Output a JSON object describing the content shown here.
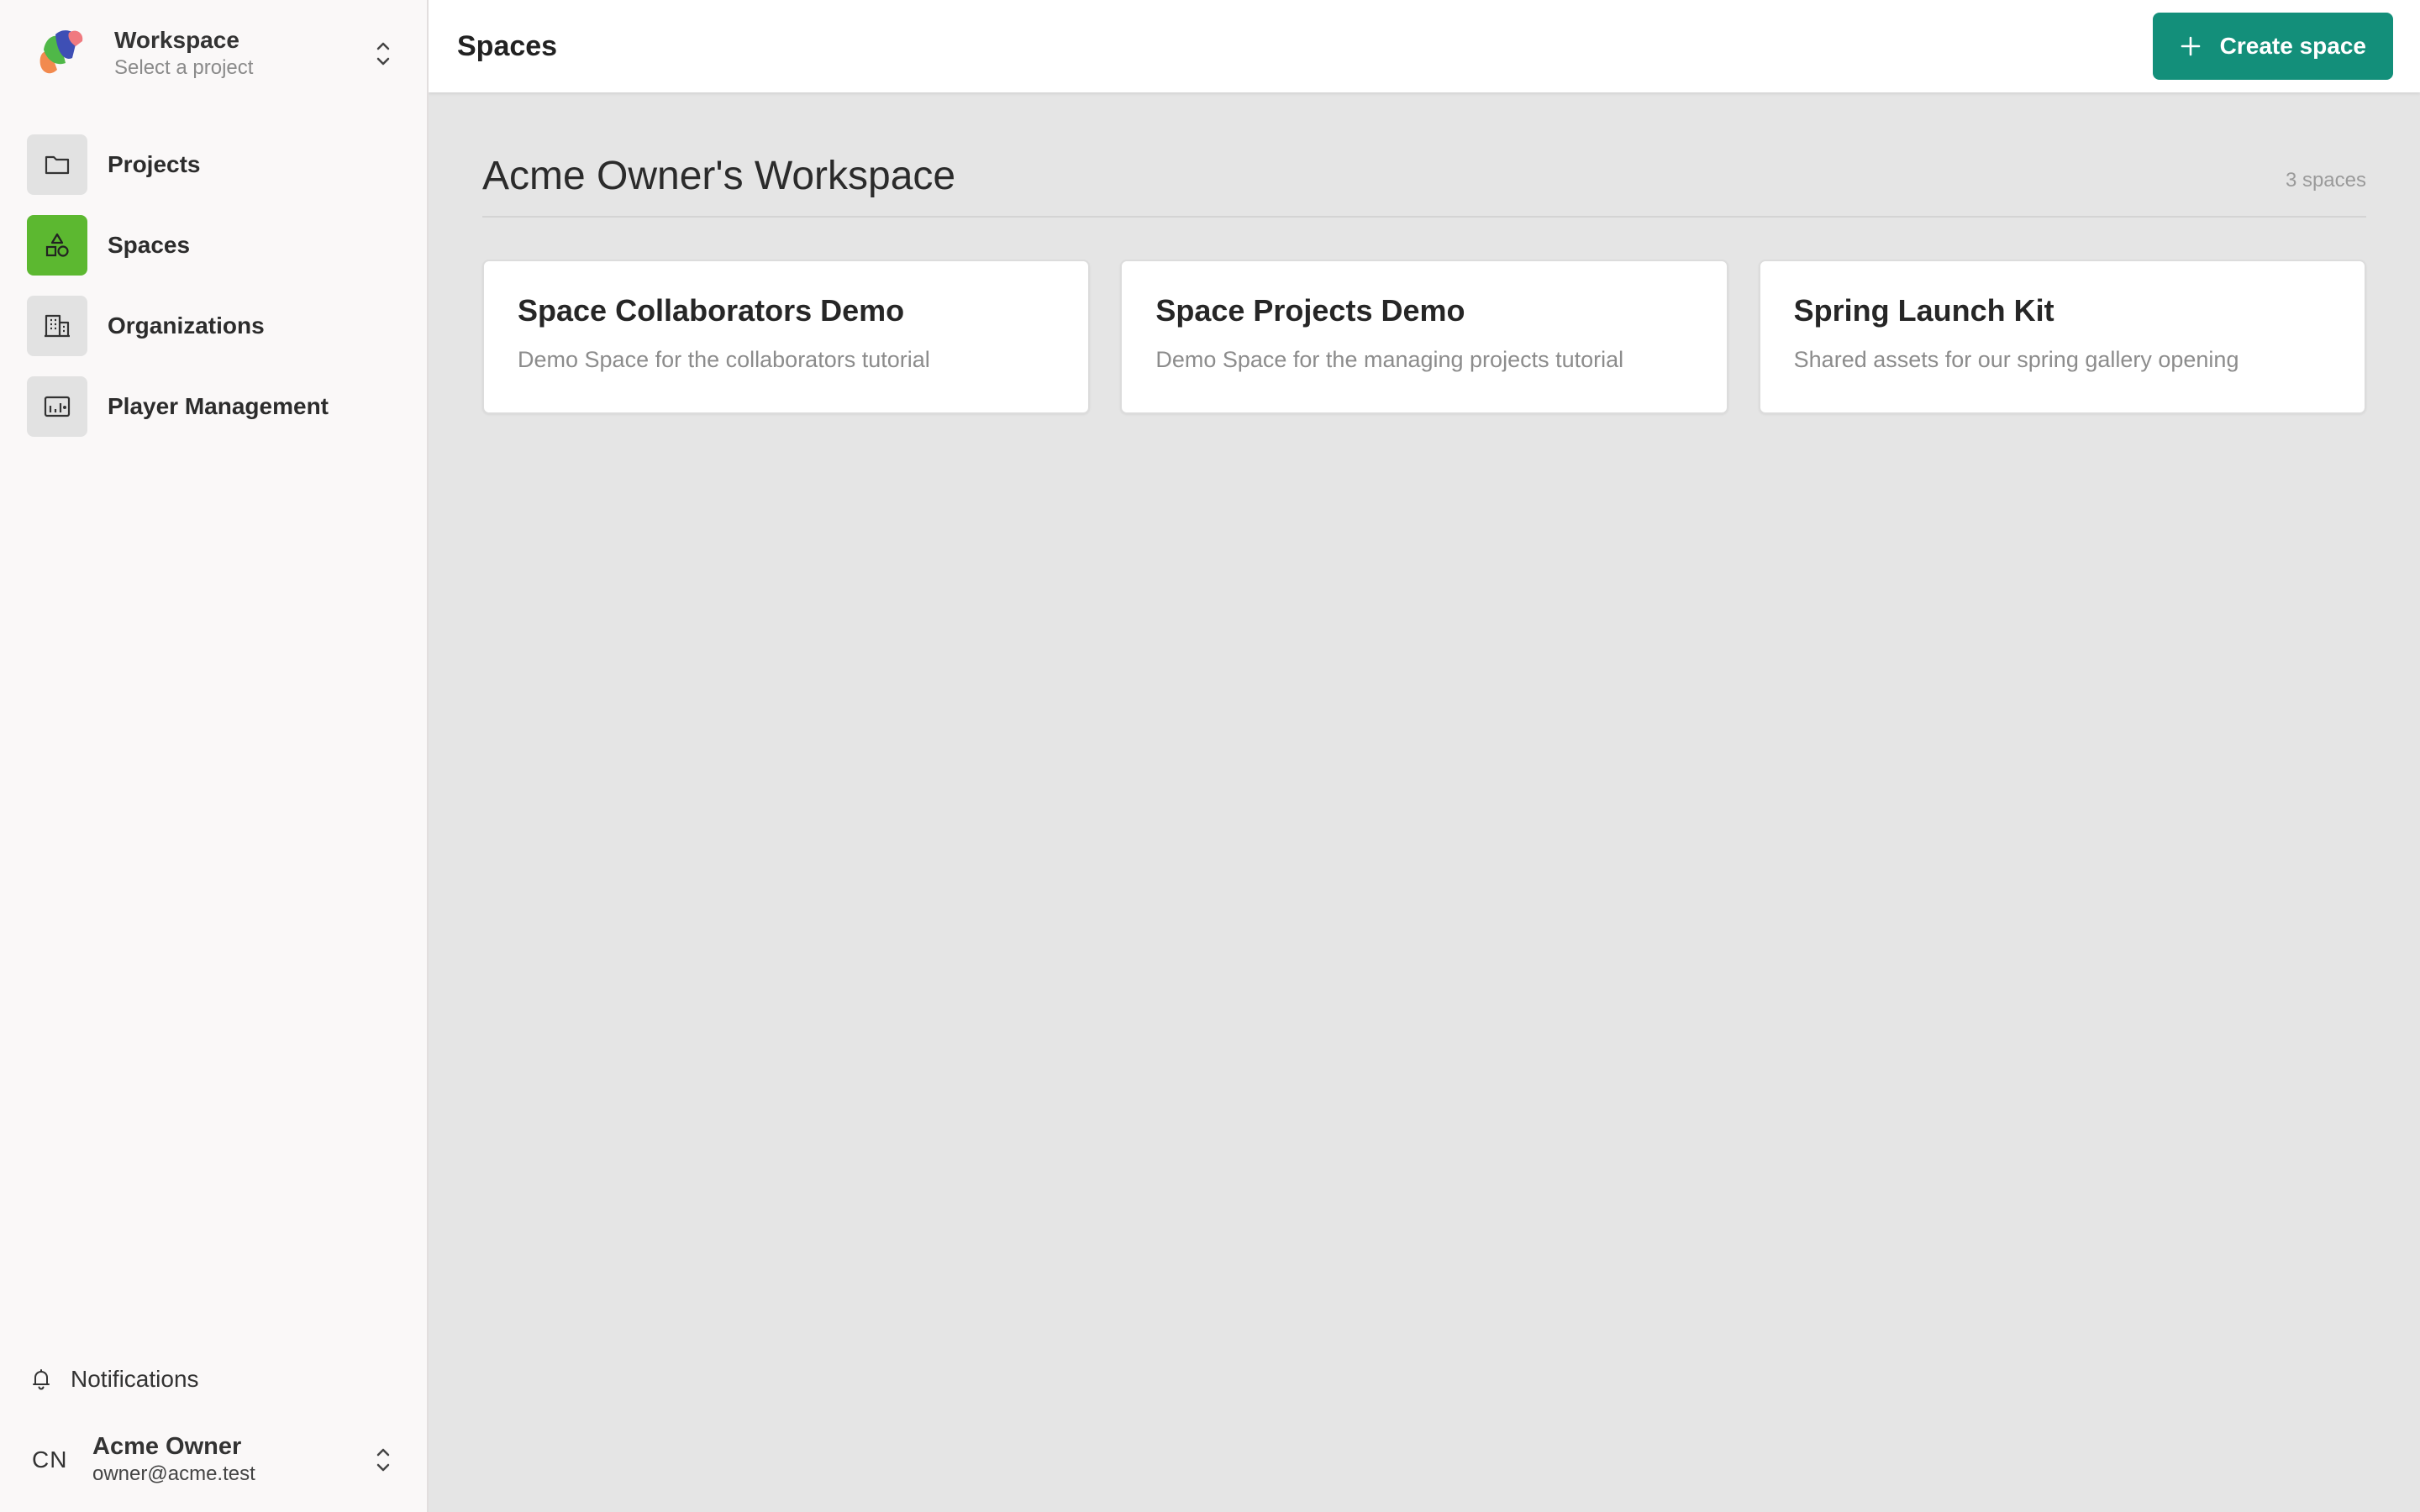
{
  "workspace_switcher": {
    "title": "Workspace",
    "subtitle": "Select a project",
    "logo_icon": "workspace-logo",
    "chevron_icon": "chevron-up-down-icon"
  },
  "sidebar": {
    "items": [
      {
        "label": "Projects",
        "icon": "folder-icon",
        "active": false
      },
      {
        "label": "Spaces",
        "icon": "shapes-icon",
        "active": true
      },
      {
        "label": "Organizations",
        "icon": "building-icon",
        "active": false
      },
      {
        "label": "Player Management",
        "icon": "player-management-icon",
        "active": false
      }
    ],
    "notifications_label": "Notifications",
    "user": {
      "initials": "CN",
      "name": "Acme Owner",
      "email": "owner@acme.test"
    }
  },
  "header": {
    "title": "Spaces",
    "create_label": "Create space"
  },
  "main": {
    "workspace_heading": "Acme Owner's Workspace",
    "spaces_count": "3 spaces",
    "cards": [
      {
        "title": "Space Collaborators Demo",
        "description": "Demo Space for the collaborators tutorial"
      },
      {
        "title": "Space Projects Demo",
        "description": "Demo Space for the managing projects tutorial"
      },
      {
        "title": "Spring Launch Kit",
        "description": "Shared assets for our spring gallery opening"
      }
    ]
  },
  "colors": {
    "accent": "#138f7a",
    "active_nav": "#5cb830",
    "background": "#e5e5e5",
    "sidebar_bg": "#faf8f8"
  }
}
